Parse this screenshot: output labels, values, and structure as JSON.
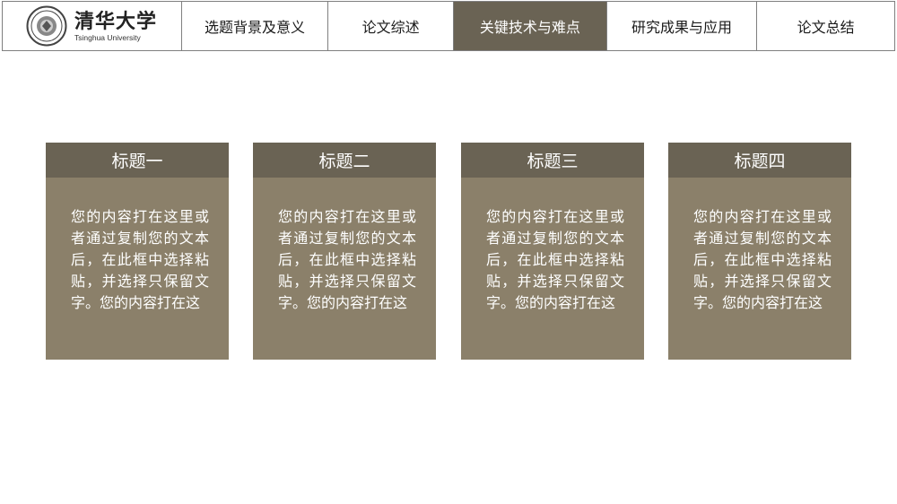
{
  "logo": {
    "name_cn": "清华大学",
    "name_en": "Tsinghua University",
    "icon": "university-seal-icon"
  },
  "nav": {
    "tabs": [
      {
        "label": "选题背景及意义"
      },
      {
        "label": "论文综述"
      },
      {
        "label": "关键技术与难点"
      },
      {
        "label": "研究成果与应用"
      },
      {
        "label": "论文总结"
      }
    ],
    "active_index": 2
  },
  "cards": [
    {
      "title": "标题一",
      "body": "您的内容打在这里或者通过复制您的文本后，在此框中选择粘贴，并选择只保留文字。您的内容打在这"
    },
    {
      "title": "标题二",
      "body": "您的内容打在这里或者通过复制您的文本后，在此框中选择粘贴，并选择只保留文字。您的内容打在这"
    },
    {
      "title": "标题三",
      "body": "您的内容打在这里或者通过复制您的文本后，在此框中选择粘贴，并选择只保留文字。您的内容打在这"
    },
    {
      "title": "标题四",
      "body": "您的内容打在这里或者通过复制您的文本后，在此框中选择粘贴，并选择只保留文字。您的内容打在这"
    }
  ],
  "colors": {
    "accent_dark": "#6a6354",
    "card_body": "#8b806a",
    "border": "#7f7f7f"
  }
}
